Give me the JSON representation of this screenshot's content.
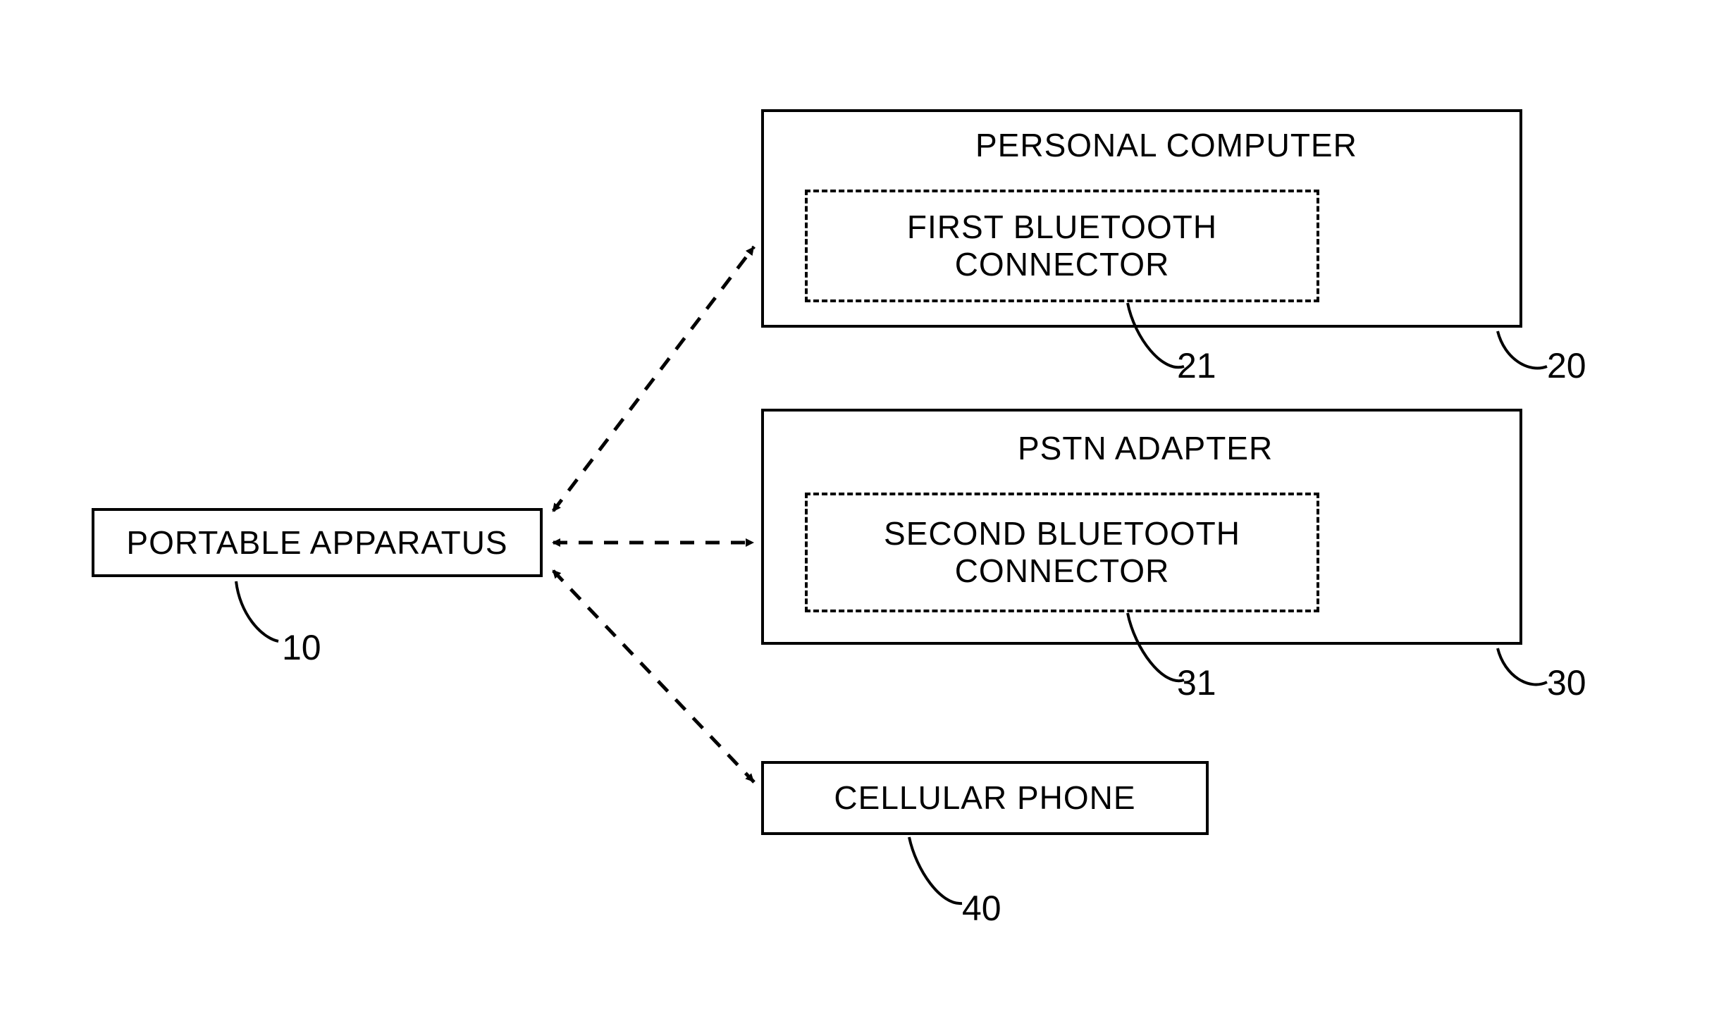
{
  "blocks": {
    "portable": {
      "label": "PORTABLE APPARATUS",
      "ref": "10"
    },
    "pc": {
      "title": "PERSONAL COMPUTER",
      "inner": "FIRST BLUETOOTH\nCONNECTOR",
      "ref_outer": "20",
      "ref_inner": "21"
    },
    "pstn": {
      "title": "PSTN ADAPTER",
      "inner": "SECOND BLUETOOTH\nCONNECTOR",
      "ref_outer": "30",
      "ref_inner": "31"
    },
    "cell": {
      "label": "CELLULAR PHONE",
      "ref": "40"
    }
  }
}
